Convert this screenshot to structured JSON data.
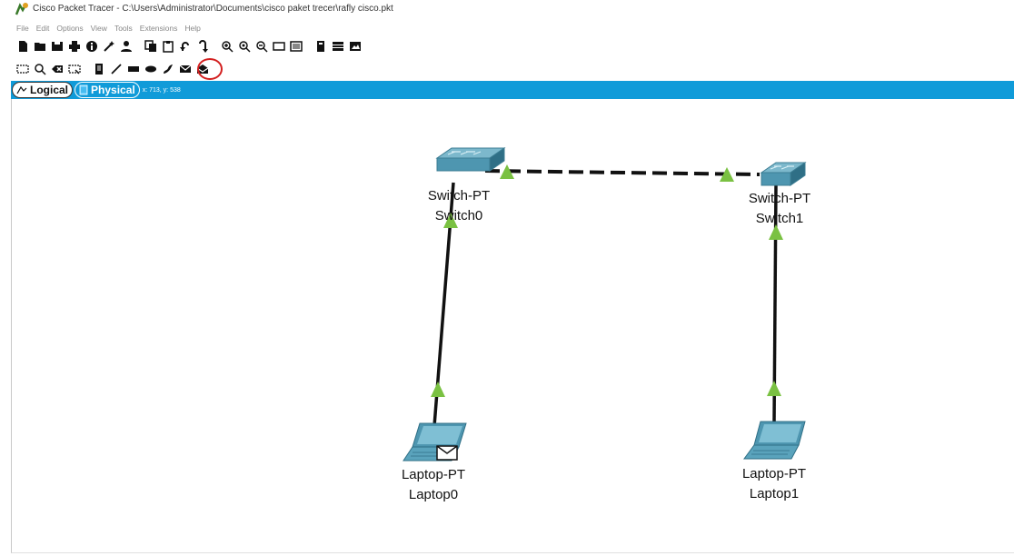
{
  "window": {
    "title": "Cisco Packet Tracer - C:\\Users\\Administrator\\Documents\\cisco paket trecer\\rafly cisco.pkt"
  },
  "menu": [
    "File",
    "Edit",
    "Options",
    "View",
    "Tools",
    "Extensions",
    "Help"
  ],
  "toolbar_main": [
    "new-icon",
    "open-icon",
    "save-icon",
    "print-icon",
    "info-icon",
    "wizard-icon",
    "user-icon",
    "copy-icon",
    "paste-icon",
    "undo-icon",
    "redo-icon",
    "zoom-in-icon",
    "zoom-reset-icon",
    "zoom-out-icon",
    "drawing-palette-icon",
    "custom-device-icon",
    "viewport-icon",
    "list-icon",
    "image-icon"
  ],
  "toolbar_common": [
    "select-icon",
    "inspect-icon",
    "delete-icon",
    "resize-icon",
    "note-icon",
    "line-icon",
    "rectangle-icon",
    "ellipse-icon",
    "freeform-icon",
    "add-simple-pdu-icon",
    "add-complex-pdu-icon"
  ],
  "tabs": {
    "logical": "Logical",
    "physical": "Physical",
    "coords": "x: 713, y: 538"
  },
  "devices": [
    {
      "id": "switch0",
      "model": "Switch-PT",
      "name": "Switch0"
    },
    {
      "id": "switch1",
      "model": "Switch-PT",
      "name": "Switch1"
    },
    {
      "id": "laptop0",
      "model": "Laptop-PT",
      "name": "Laptop0"
    },
    {
      "id": "laptop1",
      "model": "Laptop-PT",
      "name": "Laptop1"
    }
  ],
  "links": [
    {
      "from": "Switch0",
      "to": "Switch1",
      "style": "crossover",
      "status": "up"
    },
    {
      "from": "Switch0",
      "to": "Laptop0",
      "style": "straight",
      "status": "up"
    },
    {
      "from": "Switch1",
      "to": "Laptop1",
      "style": "straight",
      "status": "up"
    }
  ],
  "colors": {
    "tab_bar": "#109bd9",
    "link_up": "#7ac142",
    "switch": "#4e96b0",
    "highlight": "#d32020"
  }
}
